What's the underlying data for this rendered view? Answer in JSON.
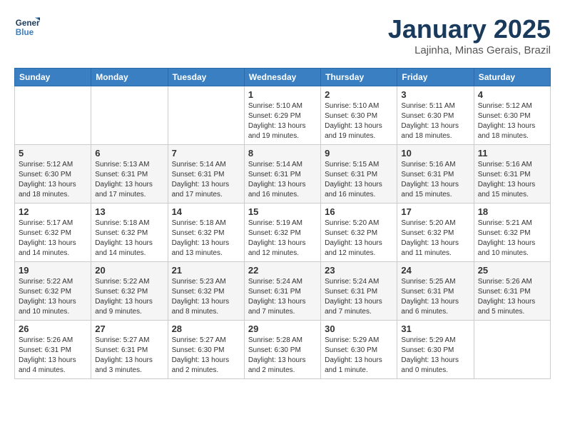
{
  "header": {
    "logo_line1": "General",
    "logo_line2": "Blue",
    "title": "January 2025",
    "subtitle": "Lajinha, Minas Gerais, Brazil"
  },
  "weekdays": [
    "Sunday",
    "Monday",
    "Tuesday",
    "Wednesday",
    "Thursday",
    "Friday",
    "Saturday"
  ],
  "weeks": [
    [
      {
        "day": "",
        "info": ""
      },
      {
        "day": "",
        "info": ""
      },
      {
        "day": "",
        "info": ""
      },
      {
        "day": "1",
        "info": "Sunrise: 5:10 AM\nSunset: 6:29 PM\nDaylight: 13 hours\nand 19 minutes."
      },
      {
        "day": "2",
        "info": "Sunrise: 5:10 AM\nSunset: 6:30 PM\nDaylight: 13 hours\nand 19 minutes."
      },
      {
        "day": "3",
        "info": "Sunrise: 5:11 AM\nSunset: 6:30 PM\nDaylight: 13 hours\nand 18 minutes."
      },
      {
        "day": "4",
        "info": "Sunrise: 5:12 AM\nSunset: 6:30 PM\nDaylight: 13 hours\nand 18 minutes."
      }
    ],
    [
      {
        "day": "5",
        "info": "Sunrise: 5:12 AM\nSunset: 6:30 PM\nDaylight: 13 hours\nand 18 minutes."
      },
      {
        "day": "6",
        "info": "Sunrise: 5:13 AM\nSunset: 6:31 PM\nDaylight: 13 hours\nand 17 minutes."
      },
      {
        "day": "7",
        "info": "Sunrise: 5:14 AM\nSunset: 6:31 PM\nDaylight: 13 hours\nand 17 minutes."
      },
      {
        "day": "8",
        "info": "Sunrise: 5:14 AM\nSunset: 6:31 PM\nDaylight: 13 hours\nand 16 minutes."
      },
      {
        "day": "9",
        "info": "Sunrise: 5:15 AM\nSunset: 6:31 PM\nDaylight: 13 hours\nand 16 minutes."
      },
      {
        "day": "10",
        "info": "Sunrise: 5:16 AM\nSunset: 6:31 PM\nDaylight: 13 hours\nand 15 minutes."
      },
      {
        "day": "11",
        "info": "Sunrise: 5:16 AM\nSunset: 6:31 PM\nDaylight: 13 hours\nand 15 minutes."
      }
    ],
    [
      {
        "day": "12",
        "info": "Sunrise: 5:17 AM\nSunset: 6:32 PM\nDaylight: 13 hours\nand 14 minutes."
      },
      {
        "day": "13",
        "info": "Sunrise: 5:18 AM\nSunset: 6:32 PM\nDaylight: 13 hours\nand 14 minutes."
      },
      {
        "day": "14",
        "info": "Sunrise: 5:18 AM\nSunset: 6:32 PM\nDaylight: 13 hours\nand 13 minutes."
      },
      {
        "day": "15",
        "info": "Sunrise: 5:19 AM\nSunset: 6:32 PM\nDaylight: 13 hours\nand 12 minutes."
      },
      {
        "day": "16",
        "info": "Sunrise: 5:20 AM\nSunset: 6:32 PM\nDaylight: 13 hours\nand 12 minutes."
      },
      {
        "day": "17",
        "info": "Sunrise: 5:20 AM\nSunset: 6:32 PM\nDaylight: 13 hours\nand 11 minutes."
      },
      {
        "day": "18",
        "info": "Sunrise: 5:21 AM\nSunset: 6:32 PM\nDaylight: 13 hours\nand 10 minutes."
      }
    ],
    [
      {
        "day": "19",
        "info": "Sunrise: 5:22 AM\nSunset: 6:32 PM\nDaylight: 13 hours\nand 10 minutes."
      },
      {
        "day": "20",
        "info": "Sunrise: 5:22 AM\nSunset: 6:32 PM\nDaylight: 13 hours\nand 9 minutes."
      },
      {
        "day": "21",
        "info": "Sunrise: 5:23 AM\nSunset: 6:32 PM\nDaylight: 13 hours\nand 8 minutes."
      },
      {
        "day": "22",
        "info": "Sunrise: 5:24 AM\nSunset: 6:31 PM\nDaylight: 13 hours\nand 7 minutes."
      },
      {
        "day": "23",
        "info": "Sunrise: 5:24 AM\nSunset: 6:31 PM\nDaylight: 13 hours\nand 7 minutes."
      },
      {
        "day": "24",
        "info": "Sunrise: 5:25 AM\nSunset: 6:31 PM\nDaylight: 13 hours\nand 6 minutes."
      },
      {
        "day": "25",
        "info": "Sunrise: 5:26 AM\nSunset: 6:31 PM\nDaylight: 13 hours\nand 5 minutes."
      }
    ],
    [
      {
        "day": "26",
        "info": "Sunrise: 5:26 AM\nSunset: 6:31 PM\nDaylight: 13 hours\nand 4 minutes."
      },
      {
        "day": "27",
        "info": "Sunrise: 5:27 AM\nSunset: 6:31 PM\nDaylight: 13 hours\nand 3 minutes."
      },
      {
        "day": "28",
        "info": "Sunrise: 5:27 AM\nSunset: 6:30 PM\nDaylight: 13 hours\nand 2 minutes."
      },
      {
        "day": "29",
        "info": "Sunrise: 5:28 AM\nSunset: 6:30 PM\nDaylight: 13 hours\nand 2 minutes."
      },
      {
        "day": "30",
        "info": "Sunrise: 5:29 AM\nSunset: 6:30 PM\nDaylight: 13 hours\nand 1 minute."
      },
      {
        "day": "31",
        "info": "Sunrise: 5:29 AM\nSunset: 6:30 PM\nDaylight: 13 hours\nand 0 minutes."
      },
      {
        "day": "",
        "info": ""
      }
    ]
  ]
}
